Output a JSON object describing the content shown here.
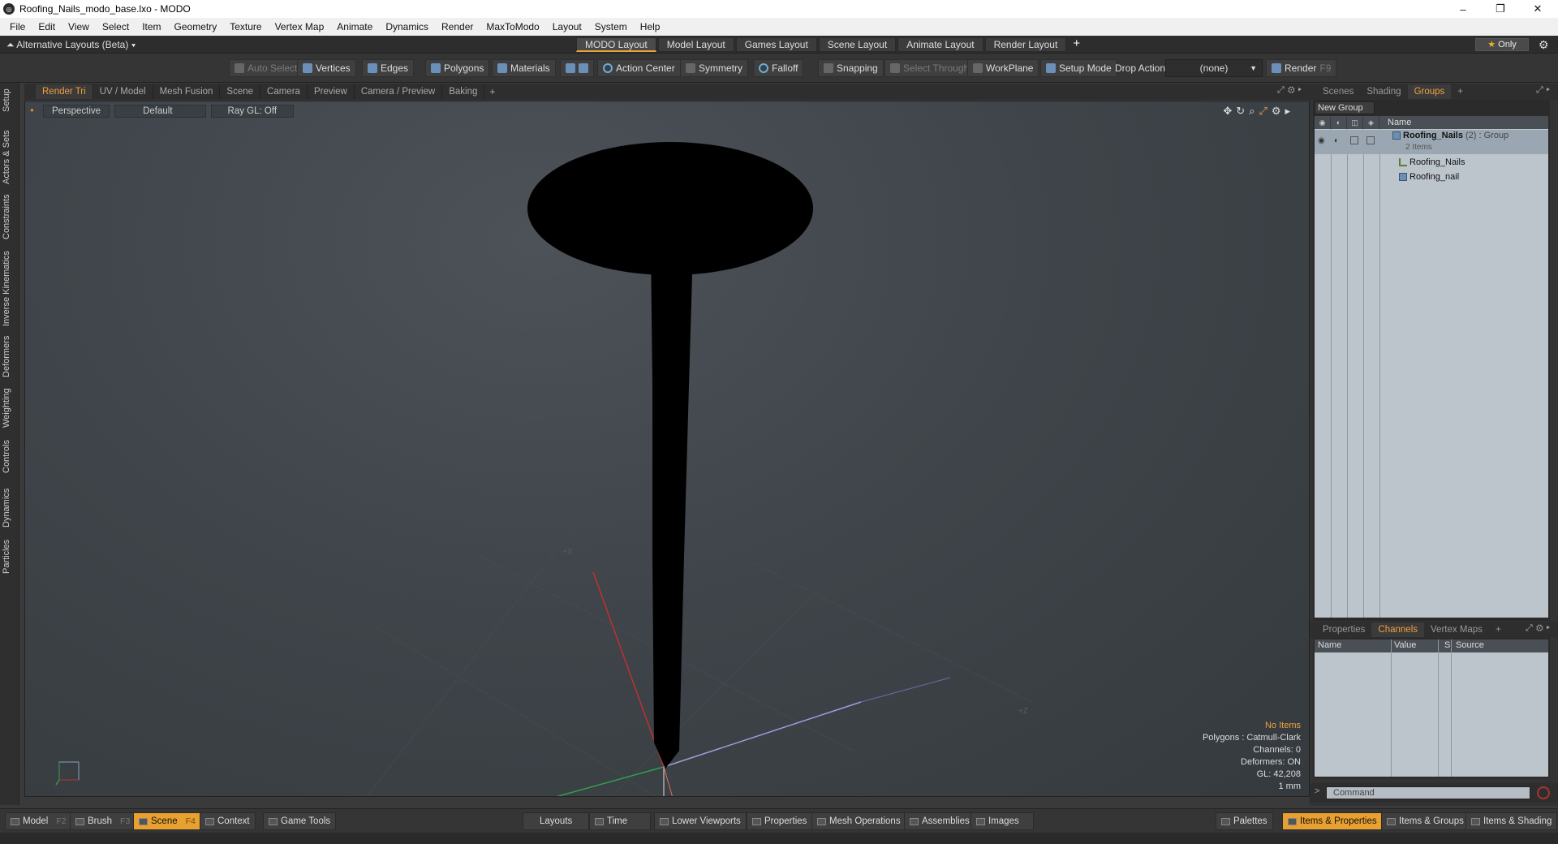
{
  "window": {
    "title": "Roofing_Nails_modo_base.lxo - MODO",
    "controls": [
      "–",
      "❐",
      "✕"
    ]
  },
  "menubar": [
    "File",
    "Edit",
    "View",
    "Select",
    "Item",
    "Geometry",
    "Texture",
    "Vertex Map",
    "Animate",
    "Dynamics",
    "Render",
    "MaxToModo",
    "Layout",
    "System",
    "Help"
  ],
  "layoutbar": {
    "alt_layouts": "Alternative Layouts (Beta) ▾",
    "tabs": [
      "MODO Layout",
      "Model Layout",
      "Games Layout",
      "Scene Layout",
      "Animate Layout",
      "Render Layout"
    ],
    "active_tab": "MODO Layout",
    "add": "+",
    "only": "Only"
  },
  "toolbar": {
    "auto_select": "Auto Select",
    "vertices": "Vertices",
    "edges": "Edges",
    "polygons": "Polygons",
    "materials": "Materials",
    "action_center": "Action Center",
    "symmetry": "Symmetry",
    "falloff": "Falloff",
    "snapping": "Snapping",
    "select_through": "Select Through",
    "workplane": "WorkPlane",
    "setup_mode": "Setup Mode",
    "drop_action": "Drop Action",
    "drop_value": "(none)",
    "render": "Render",
    "render_key": "F9"
  },
  "left_tabs": [
    "Setup",
    "Actors & Sets",
    "Constraints",
    "Inverse Kinematics",
    "Deformers",
    "Weighting",
    "Controls",
    "Dynamics",
    "Particles"
  ],
  "viewport_tabs": [
    "Render Tri",
    "UV / Model",
    "Mesh Fusion",
    "Scene",
    "Camera",
    "Preview",
    "Camera / Preview",
    "Baking"
  ],
  "viewport_active_tab": "Render Tri",
  "viewport": {
    "projection": "Perspective",
    "shading": "Default",
    "raygl": "Ray GL: Off",
    "info": {
      "no_items": "No Items",
      "polygons": "Polygons : Catmull-Clark",
      "channels": "Channels: 0",
      "deformers": "Deformers: ON",
      "gl": "GL: 42,208",
      "scale": "1 mm"
    }
  },
  "right_top_tabs": [
    "Scenes",
    "Shading",
    "Groups"
  ],
  "right_top_active": "Groups",
  "groups": {
    "new_group": "New Group",
    "header_name": "Name",
    "root_name": "Roofing_Nails",
    "root_suffix": "(2) : Group",
    "root_count": "2 Items",
    "children": [
      "Roofing_Nails",
      "Roofing_nail"
    ]
  },
  "right_bottom_tabs": [
    "Properties",
    "Channels",
    "Vertex Maps"
  ],
  "right_bottom_active": "Channels",
  "channels": {
    "col_name": "Name",
    "col_value": "Value",
    "col_s": "S",
    "col_source": "Source"
  },
  "command": {
    "placeholder": "Command",
    "prompt": ">"
  },
  "bottombar": {
    "model": "Model",
    "model_key": "F2",
    "brush": "Brush",
    "brush_key": "F3",
    "scene": "Scene",
    "scene_key": "F4",
    "context": "Context",
    "game_tools": "Game Tools",
    "layouts": "Layouts",
    "time": "Time",
    "lower_viewports": "Lower Viewports",
    "properties": "Properties",
    "mesh_operations": "Mesh Operations",
    "assemblies": "Assemblies",
    "images": "Images",
    "palettes": "Palettes",
    "items_properties": "Items & Properties",
    "items_groups": "Items & Groups",
    "items_shading": "Items & Shading"
  },
  "colors": {
    "accent": "#f0a040",
    "nail": "#000000"
  }
}
